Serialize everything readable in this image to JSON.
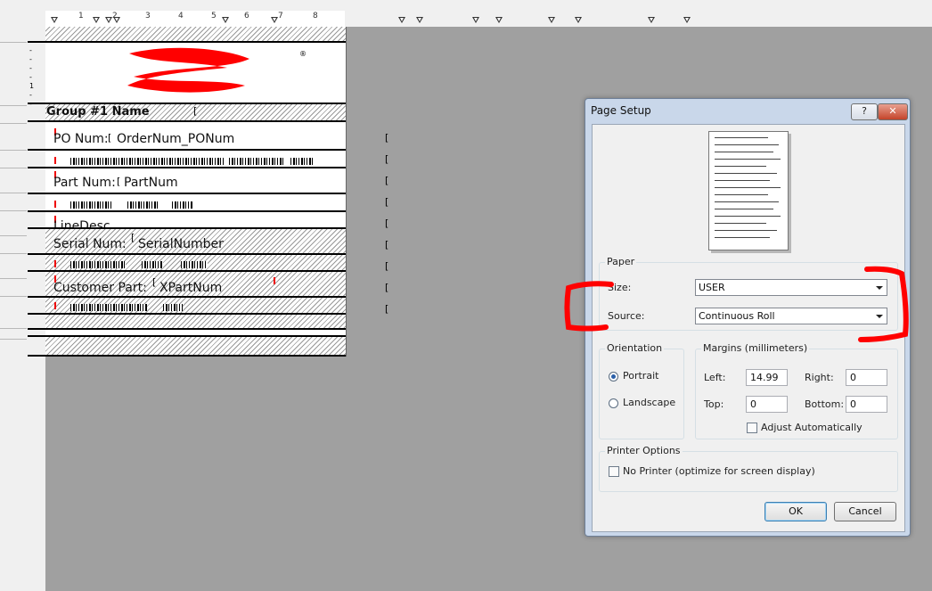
{
  "ruler": {
    "numbers": [
      "1",
      "2",
      "3",
      "4",
      "5",
      "6",
      "7",
      "8"
    ]
  },
  "report": {
    "group_header": "Group #1 Name",
    "po_label": "PO Num:",
    "po_field": "OrderNum_PONum",
    "part_label": "Part Num:",
    "part_field": "PartNum",
    "linedesc_field": "LineDesc",
    "serial_label": "Serial Num:",
    "serial_field": "SerialNumber",
    "cust_label": "Customer Part:",
    "cust_field": "XPartNum",
    "logo_mark": "®"
  },
  "dialog": {
    "title": "Page Setup",
    "help": "?",
    "close": "✕",
    "paper": {
      "group_label": "Paper",
      "size_label": "Size:",
      "size_value": "USER",
      "source_label": "Source:",
      "source_value": "Continuous Roll"
    },
    "orientation": {
      "group_label": "Orientation",
      "portrait": "Portrait",
      "landscape": "Landscape",
      "selected": "Portrait"
    },
    "margins": {
      "group_label": "Margins (millimeters)",
      "left_label": "Left:",
      "left_value": "14.99",
      "right_label": "Right:",
      "right_value": "0",
      "top_label": "Top:",
      "top_value": "0",
      "bottom_label": "Bottom:",
      "bottom_value": "0",
      "adjust_label": "Adjust Automatically",
      "adjust_checked": false
    },
    "printer": {
      "group_label": "Printer Options",
      "no_printer_label": "No Printer (optimize for screen display)",
      "no_printer_checked": false
    },
    "ok": "OK",
    "cancel": "Cancel"
  },
  "annotation_color": "#ff0000"
}
